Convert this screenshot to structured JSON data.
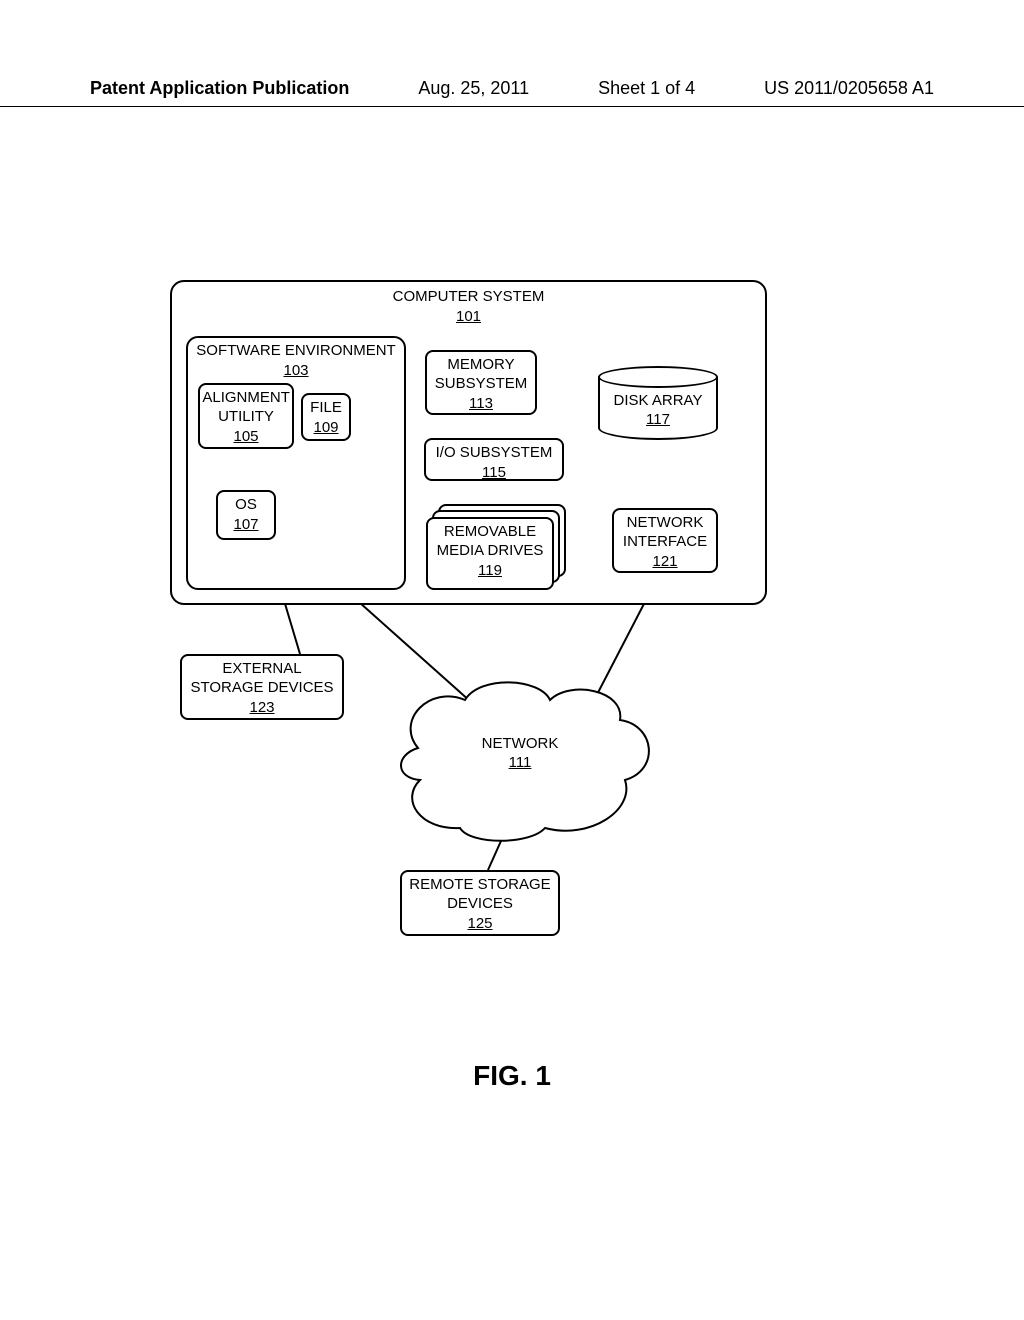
{
  "header": {
    "left": "Patent Application Publication",
    "date": "Aug. 25, 2011",
    "sheet": "Sheet 1 of 4",
    "pubno": "US 2011/0205658 A1"
  },
  "figure_label": "FIG. 1",
  "blocks": {
    "computer_system": {
      "label": "COMPUTER SYSTEM",
      "ref": "101"
    },
    "software_env": {
      "label": "SOFTWARE ENVIRONMENT",
      "ref": "103"
    },
    "alignment_util": {
      "label": "ALIGNMENT UTILITY",
      "ref": "105"
    },
    "file": {
      "label": "FILE",
      "ref": "109"
    },
    "os": {
      "label": "OS",
      "ref": "107"
    },
    "memory_subsys": {
      "label": "MEMORY SUBSYSTEM",
      "ref": "113"
    },
    "io_subsys": {
      "label": "I/O SUBSYSTEM",
      "ref": "115"
    },
    "disk_array": {
      "label": "DISK ARRAY",
      "ref": "117"
    },
    "removable": {
      "label": "REMOVABLE MEDIA DRIVES",
      "ref": "119"
    },
    "net_interface": {
      "label": "NETWORK INTERFACE",
      "ref": "121"
    },
    "external_storage": {
      "label": "EXTERNAL STORAGE DEVICES",
      "ref": "123"
    },
    "network": {
      "label": "NETWORK",
      "ref": "111"
    },
    "remote_storage": {
      "label": "REMOTE STORAGE DEVICES",
      "ref": "125"
    }
  }
}
